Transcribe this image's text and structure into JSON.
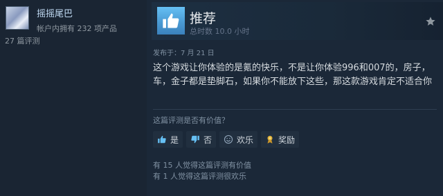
{
  "reviewer": {
    "name": "摇摇尾巴",
    "products_owned": "帐户内拥有 232 项产品",
    "review_count": "27 篇评测"
  },
  "review": {
    "verdict": "推荐",
    "hours": "总时数 10.0 小时",
    "posted": "发布于：7 月 21 日",
    "text": "这个游戏让你体验的是氪的快乐，不是让你体验996和007的，房子，车，金子都是垫脚石，如果你不能放下这些，那这款游戏肯定不适合你",
    "helpful_question": "这篇评测是否有价值？",
    "buttons": {
      "yes": "是",
      "no": "否",
      "funny": "欢乐",
      "award": "奖励"
    },
    "helpful_count": "有 15 人觉得这篇评测有价值",
    "funny_count": "有 1 人觉得这篇评测很欢乐"
  },
  "colors": {
    "background": "#1b2838",
    "accent": "#66c0f4",
    "award": "#e1b33a"
  }
}
